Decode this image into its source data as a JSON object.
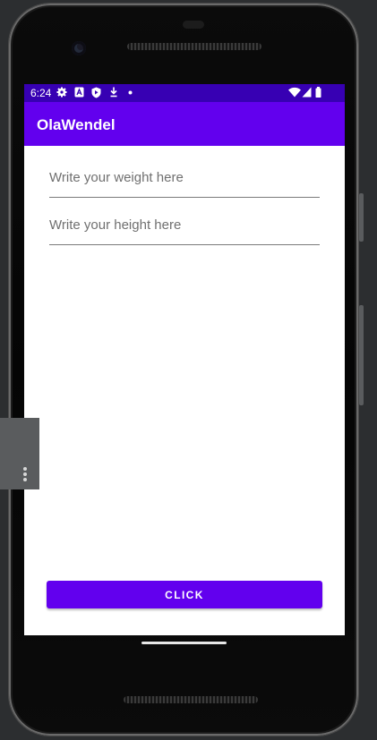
{
  "status_bar": {
    "time": "6:24",
    "left_icons": [
      "settings-icon",
      "a-badge-icon",
      "shield-play-icon",
      "download-icon",
      "dot-icon"
    ],
    "right_icons": [
      "wifi-icon",
      "signal-icon",
      "battery-icon"
    ]
  },
  "app_bar": {
    "title": "OlaWendel"
  },
  "form": {
    "weight_placeholder": "Write your weight here",
    "height_placeholder": "Write your height here",
    "click_label": "CLICK"
  },
  "colors": {
    "status_bar": "#3700b3",
    "primary": "#6200ee",
    "background": "#ffffff"
  }
}
